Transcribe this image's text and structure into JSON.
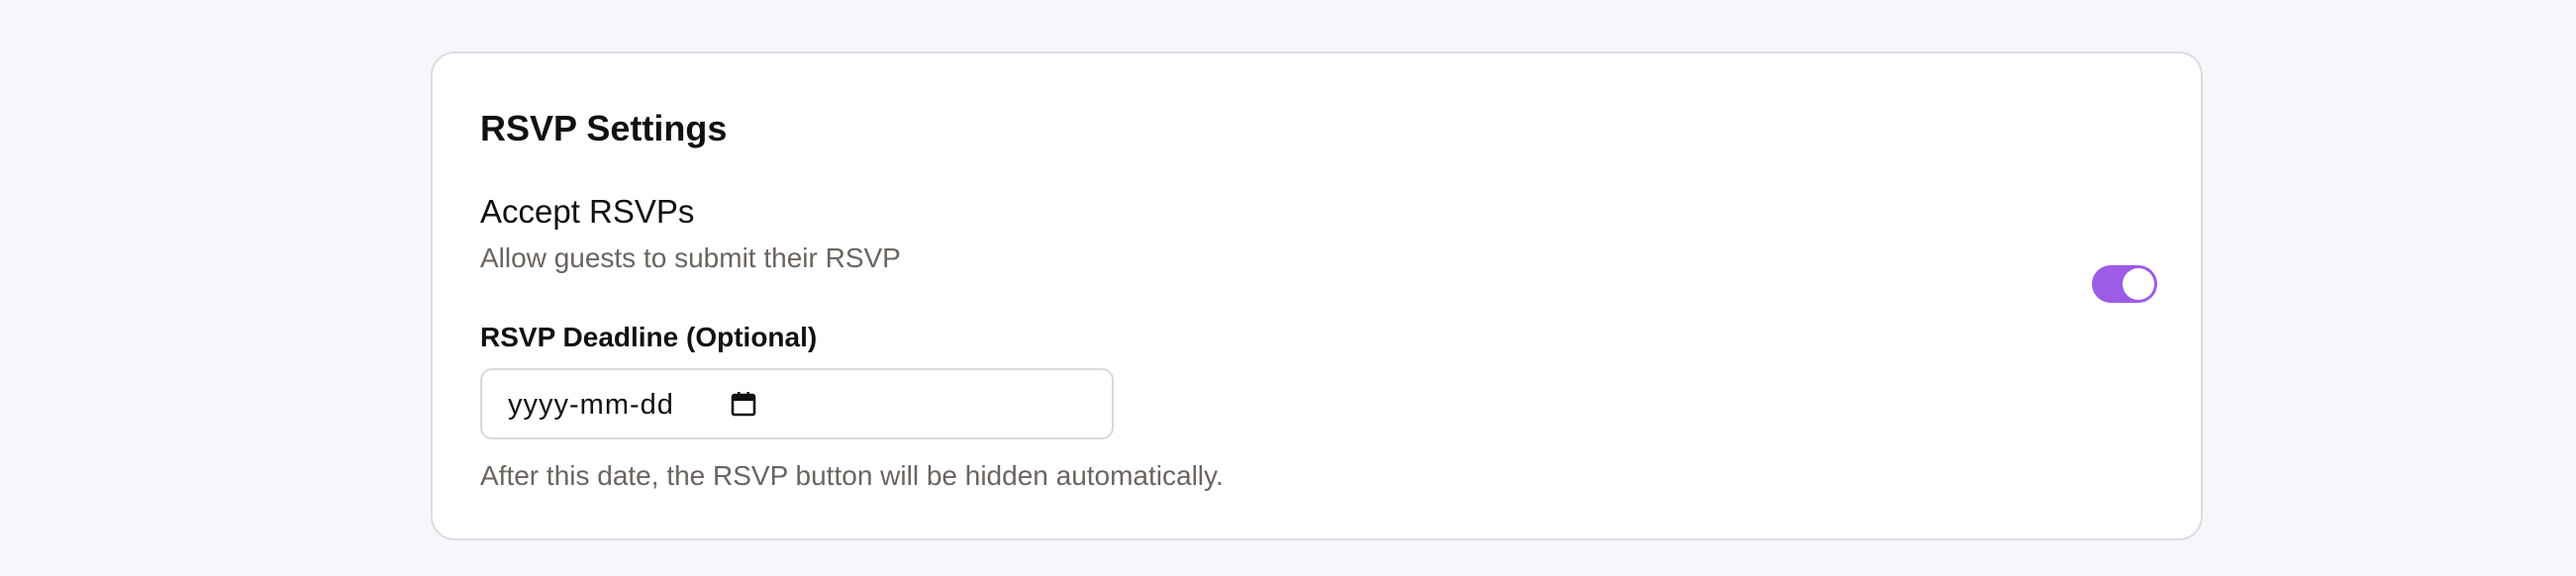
{
  "card": {
    "title": "RSVP Settings"
  },
  "accept_rsvps": {
    "label": "Accept RSVPs",
    "description": "Allow guests to submit their RSVP",
    "enabled": true
  },
  "deadline": {
    "label": "RSVP Deadline (Optional)",
    "placeholder": "yyyy-mm-dd",
    "value": "",
    "help": "After this date, the RSVP button will be hidden automatically."
  },
  "colors": {
    "accent": "#9c5ce6",
    "background": "#f7f7fb",
    "muted_text": "#6b6460"
  },
  "icons": {
    "calendar": "calendar-icon"
  }
}
